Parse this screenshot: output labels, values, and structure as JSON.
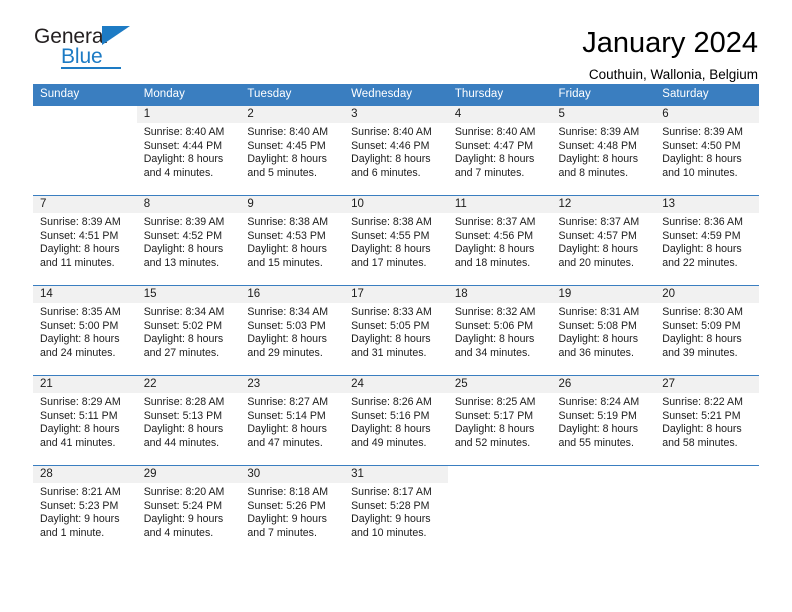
{
  "brand": {
    "name_primary": "General",
    "name_secondary": "Blue"
  },
  "header": {
    "title": "January 2024",
    "subtitle": "Couthuin, Wallonia, Belgium"
  },
  "calendar": {
    "weekday_headers": [
      "Sunday",
      "Monday",
      "Tuesday",
      "Wednesday",
      "Thursday",
      "Friday",
      "Saturday"
    ],
    "accent_color": "#3a7ec0",
    "daynum_band_color": "#f1f1f1",
    "weeks": [
      [
        {
          "day": "",
          "sunrise": "",
          "sunset": "",
          "daylight_line1": "",
          "daylight_line2": ""
        },
        {
          "day": "1",
          "sunrise": "Sunrise: 8:40 AM",
          "sunset": "Sunset: 4:44 PM",
          "daylight_line1": "Daylight: 8 hours",
          "daylight_line2": "and 4 minutes."
        },
        {
          "day": "2",
          "sunrise": "Sunrise: 8:40 AM",
          "sunset": "Sunset: 4:45 PM",
          "daylight_line1": "Daylight: 8 hours",
          "daylight_line2": "and 5 minutes."
        },
        {
          "day": "3",
          "sunrise": "Sunrise: 8:40 AM",
          "sunset": "Sunset: 4:46 PM",
          "daylight_line1": "Daylight: 8 hours",
          "daylight_line2": "and 6 minutes."
        },
        {
          "day": "4",
          "sunrise": "Sunrise: 8:40 AM",
          "sunset": "Sunset: 4:47 PM",
          "daylight_line1": "Daylight: 8 hours",
          "daylight_line2": "and 7 minutes."
        },
        {
          "day": "5",
          "sunrise": "Sunrise: 8:39 AM",
          "sunset": "Sunset: 4:48 PM",
          "daylight_line1": "Daylight: 8 hours",
          "daylight_line2": "and 8 minutes."
        },
        {
          "day": "6",
          "sunrise": "Sunrise: 8:39 AM",
          "sunset": "Sunset: 4:50 PM",
          "daylight_line1": "Daylight: 8 hours",
          "daylight_line2": "and 10 minutes."
        }
      ],
      [
        {
          "day": "7",
          "sunrise": "Sunrise: 8:39 AM",
          "sunset": "Sunset: 4:51 PM",
          "daylight_line1": "Daylight: 8 hours",
          "daylight_line2": "and 11 minutes."
        },
        {
          "day": "8",
          "sunrise": "Sunrise: 8:39 AM",
          "sunset": "Sunset: 4:52 PM",
          "daylight_line1": "Daylight: 8 hours",
          "daylight_line2": "and 13 minutes."
        },
        {
          "day": "9",
          "sunrise": "Sunrise: 8:38 AM",
          "sunset": "Sunset: 4:53 PM",
          "daylight_line1": "Daylight: 8 hours",
          "daylight_line2": "and 15 minutes."
        },
        {
          "day": "10",
          "sunrise": "Sunrise: 8:38 AM",
          "sunset": "Sunset: 4:55 PM",
          "daylight_line1": "Daylight: 8 hours",
          "daylight_line2": "and 17 minutes."
        },
        {
          "day": "11",
          "sunrise": "Sunrise: 8:37 AM",
          "sunset": "Sunset: 4:56 PM",
          "daylight_line1": "Daylight: 8 hours",
          "daylight_line2": "and 18 minutes."
        },
        {
          "day": "12",
          "sunrise": "Sunrise: 8:37 AM",
          "sunset": "Sunset: 4:57 PM",
          "daylight_line1": "Daylight: 8 hours",
          "daylight_line2": "and 20 minutes."
        },
        {
          "day": "13",
          "sunrise": "Sunrise: 8:36 AM",
          "sunset": "Sunset: 4:59 PM",
          "daylight_line1": "Daylight: 8 hours",
          "daylight_line2": "and 22 minutes."
        }
      ],
      [
        {
          "day": "14",
          "sunrise": "Sunrise: 8:35 AM",
          "sunset": "Sunset: 5:00 PM",
          "daylight_line1": "Daylight: 8 hours",
          "daylight_line2": "and 24 minutes."
        },
        {
          "day": "15",
          "sunrise": "Sunrise: 8:34 AM",
          "sunset": "Sunset: 5:02 PM",
          "daylight_line1": "Daylight: 8 hours",
          "daylight_line2": "and 27 minutes."
        },
        {
          "day": "16",
          "sunrise": "Sunrise: 8:34 AM",
          "sunset": "Sunset: 5:03 PM",
          "daylight_line1": "Daylight: 8 hours",
          "daylight_line2": "and 29 minutes."
        },
        {
          "day": "17",
          "sunrise": "Sunrise: 8:33 AM",
          "sunset": "Sunset: 5:05 PM",
          "daylight_line1": "Daylight: 8 hours",
          "daylight_line2": "and 31 minutes."
        },
        {
          "day": "18",
          "sunrise": "Sunrise: 8:32 AM",
          "sunset": "Sunset: 5:06 PM",
          "daylight_line1": "Daylight: 8 hours",
          "daylight_line2": "and 34 minutes."
        },
        {
          "day": "19",
          "sunrise": "Sunrise: 8:31 AM",
          "sunset": "Sunset: 5:08 PM",
          "daylight_line1": "Daylight: 8 hours",
          "daylight_line2": "and 36 minutes."
        },
        {
          "day": "20",
          "sunrise": "Sunrise: 8:30 AM",
          "sunset": "Sunset: 5:09 PM",
          "daylight_line1": "Daylight: 8 hours",
          "daylight_line2": "and 39 minutes."
        }
      ],
      [
        {
          "day": "21",
          "sunrise": "Sunrise: 8:29 AM",
          "sunset": "Sunset: 5:11 PM",
          "daylight_line1": "Daylight: 8 hours",
          "daylight_line2": "and 41 minutes."
        },
        {
          "day": "22",
          "sunrise": "Sunrise: 8:28 AM",
          "sunset": "Sunset: 5:13 PM",
          "daylight_line1": "Daylight: 8 hours",
          "daylight_line2": "and 44 minutes."
        },
        {
          "day": "23",
          "sunrise": "Sunrise: 8:27 AM",
          "sunset": "Sunset: 5:14 PM",
          "daylight_line1": "Daylight: 8 hours",
          "daylight_line2": "and 47 minutes."
        },
        {
          "day": "24",
          "sunrise": "Sunrise: 8:26 AM",
          "sunset": "Sunset: 5:16 PM",
          "daylight_line1": "Daylight: 8 hours",
          "daylight_line2": "and 49 minutes."
        },
        {
          "day": "25",
          "sunrise": "Sunrise: 8:25 AM",
          "sunset": "Sunset: 5:17 PM",
          "daylight_line1": "Daylight: 8 hours",
          "daylight_line2": "and 52 minutes."
        },
        {
          "day": "26",
          "sunrise": "Sunrise: 8:24 AM",
          "sunset": "Sunset: 5:19 PM",
          "daylight_line1": "Daylight: 8 hours",
          "daylight_line2": "and 55 minutes."
        },
        {
          "day": "27",
          "sunrise": "Sunrise: 8:22 AM",
          "sunset": "Sunset: 5:21 PM",
          "daylight_line1": "Daylight: 8 hours",
          "daylight_line2": "and 58 minutes."
        }
      ],
      [
        {
          "day": "28",
          "sunrise": "Sunrise: 8:21 AM",
          "sunset": "Sunset: 5:23 PM",
          "daylight_line1": "Daylight: 9 hours",
          "daylight_line2": "and 1 minute."
        },
        {
          "day": "29",
          "sunrise": "Sunrise: 8:20 AM",
          "sunset": "Sunset: 5:24 PM",
          "daylight_line1": "Daylight: 9 hours",
          "daylight_line2": "and 4 minutes."
        },
        {
          "day": "30",
          "sunrise": "Sunrise: 8:18 AM",
          "sunset": "Sunset: 5:26 PM",
          "daylight_line1": "Daylight: 9 hours",
          "daylight_line2": "and 7 minutes."
        },
        {
          "day": "31",
          "sunrise": "Sunrise: 8:17 AM",
          "sunset": "Sunset: 5:28 PM",
          "daylight_line1": "Daylight: 9 hours",
          "daylight_line2": "and 10 minutes."
        },
        {
          "day": "",
          "sunrise": "",
          "sunset": "",
          "daylight_line1": "",
          "daylight_line2": ""
        },
        {
          "day": "",
          "sunrise": "",
          "sunset": "",
          "daylight_line1": "",
          "daylight_line2": ""
        },
        {
          "day": "",
          "sunrise": "",
          "sunset": "",
          "daylight_line1": "",
          "daylight_line2": ""
        }
      ]
    ]
  }
}
